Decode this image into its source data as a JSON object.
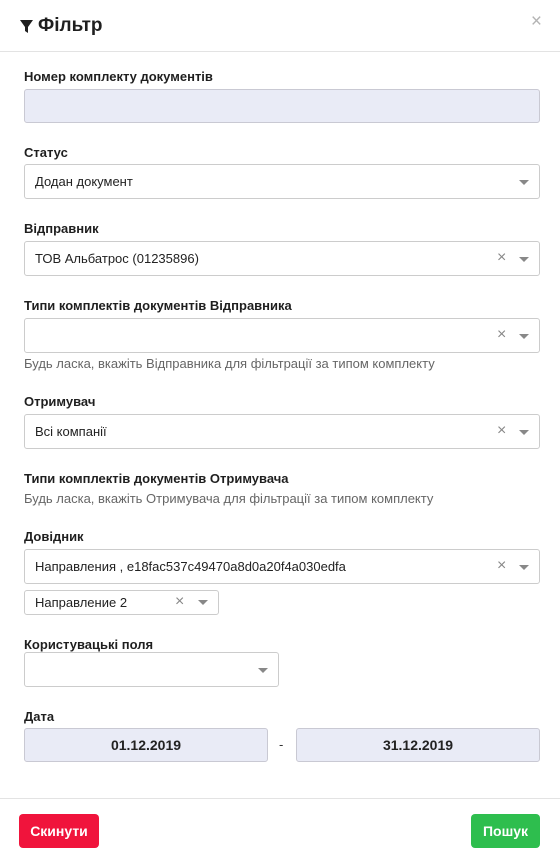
{
  "header": {
    "title": "Фільтр",
    "close": "×"
  },
  "fields": {
    "doc_set_number": {
      "label": "Номер комплекту документів",
      "value": ""
    },
    "status": {
      "label": "Статус",
      "value": "Додан документ"
    },
    "sender": {
      "label": "Відправник",
      "value": "ТОВ Альбатрос (01235896)"
    },
    "sender_set_types": {
      "label": "Типи комплектів документів Відправника",
      "value": "",
      "hint": "Будь ласка, вкажіть Відправника для фільтрації за типом комплекту"
    },
    "receiver": {
      "label": "Отримувач",
      "value": "Всі компанії"
    },
    "receiver_set_types": {
      "label": "Типи комплектів документів Отримувача",
      "hint": "Будь ласка, вкажіть Отримувача для фільтрації за типом комплекту"
    },
    "directory": {
      "label": "Довідник",
      "value": "Направления , e18fac537c49470a8d0a20f4a030edfa",
      "sub_value": "Направление 2"
    },
    "custom_fields": {
      "label": "Користувацькі поля",
      "value": ""
    },
    "date": {
      "label": "Дата",
      "from": "01.12.2019",
      "separator": "-",
      "to": "31.12.2019"
    }
  },
  "footer": {
    "reset_label": "Скинути",
    "search_label": "Пошук"
  },
  "icons": {
    "clear": "×",
    "filter": "filter-icon",
    "dropdown": "chevron-down-icon"
  },
  "colors": {
    "reset": "#f0143c",
    "search": "#2ebe4e",
    "input_bg": "#e9ebf6"
  }
}
